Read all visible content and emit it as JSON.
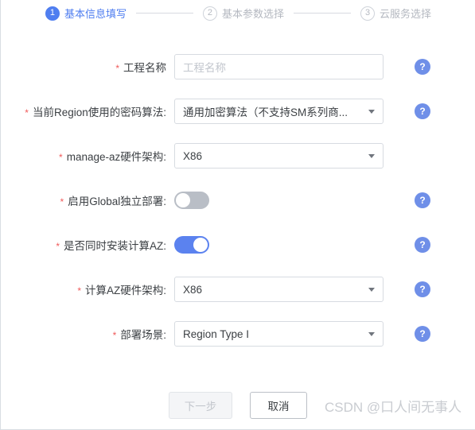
{
  "steps": [
    {
      "number": "1",
      "label": "基本信息填写",
      "state": "active"
    },
    {
      "number": "2",
      "label": "基本参数选择",
      "state": "inactive"
    },
    {
      "number": "3",
      "label": "云服务选择",
      "state": "inactive"
    }
  ],
  "form": {
    "required_mark": "*",
    "help_glyph": "?",
    "rows": [
      {
        "label": "工程名称",
        "type": "text",
        "value": "",
        "placeholder": "工程名称",
        "has_help": true
      },
      {
        "label": "当前Region使用的密码算法:",
        "type": "select",
        "value": "通用加密算法（不支持SM系列商...",
        "has_help": true
      },
      {
        "label": "manage-az硬件架构:",
        "type": "select",
        "value": "X86",
        "has_help": false
      },
      {
        "label": "启用Global独立部署:",
        "type": "toggle",
        "value": "off",
        "has_help": true
      },
      {
        "label": "是否同时安装计算AZ:",
        "type": "toggle",
        "value": "on",
        "has_help": true
      },
      {
        "label": "计算AZ硬件架构:",
        "type": "select",
        "value": "X86",
        "has_help": true
      },
      {
        "label": "部署场景:",
        "type": "select",
        "value": "Region Type I",
        "has_help": true
      }
    ]
  },
  "footer": {
    "next_label": "下一步",
    "cancel_label": "取消",
    "watermark": "CSDN @口人间无事人"
  },
  "colors": {
    "accent": "#4f7ef0",
    "toggle_on": "#5b82ef",
    "toggle_off": "#b9bec6",
    "required": "#f05a5a",
    "help_icon": "#6f8fe8"
  }
}
